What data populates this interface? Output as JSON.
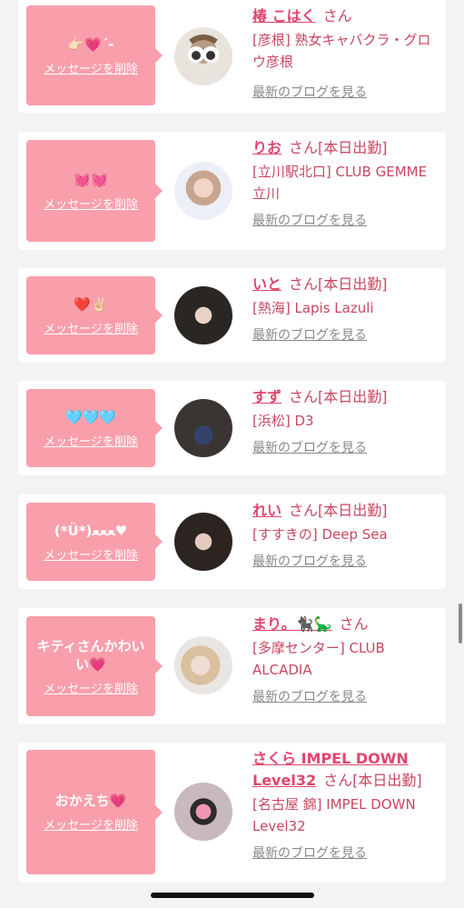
{
  "delete_label": "メッセージを削除",
  "blog_label": "最新のブログを見る",
  "honorific": "さん",
  "cards": [
    {
      "message": "👉🏻💗ˊ-",
      "name": "椿 こはく",
      "status": "",
      "shop": "[彦根] 熟女キャバクラ・グロウ彦根"
    },
    {
      "message": "💓💓",
      "name": "りお",
      "status": "[本日出勤]",
      "shop": "[立川駅北口] CLUB GEMME立川"
    },
    {
      "message": "❤️✌🏻",
      "name": "いと",
      "status": "[本日出勤]",
      "shop": "[熱海] Lapis Lazuli"
    },
    {
      "message": "🩵🩵🩵",
      "name": "すず",
      "status": "[本日出勤]",
      "shop": "[浜松] D3"
    },
    {
      "message": "(*Ü*)ﻌﻌﻌ♥",
      "name": "れい",
      "status": "[本日出勤]",
      "shop": "[すすきの] Deep Sea"
    },
    {
      "message": "キティさんかわいい💗",
      "name": "まり。🐈‍⬛🦕",
      "status": "",
      "shop": "[多摩センター] CLUB ALCADIA"
    },
    {
      "message": "おかえち💗",
      "name": "さくら IMPEL DOWN Level32",
      "status": "[本日出勤]",
      "shop": "[名古屋 錦] IMPEL DOWN Level32"
    }
  ]
}
